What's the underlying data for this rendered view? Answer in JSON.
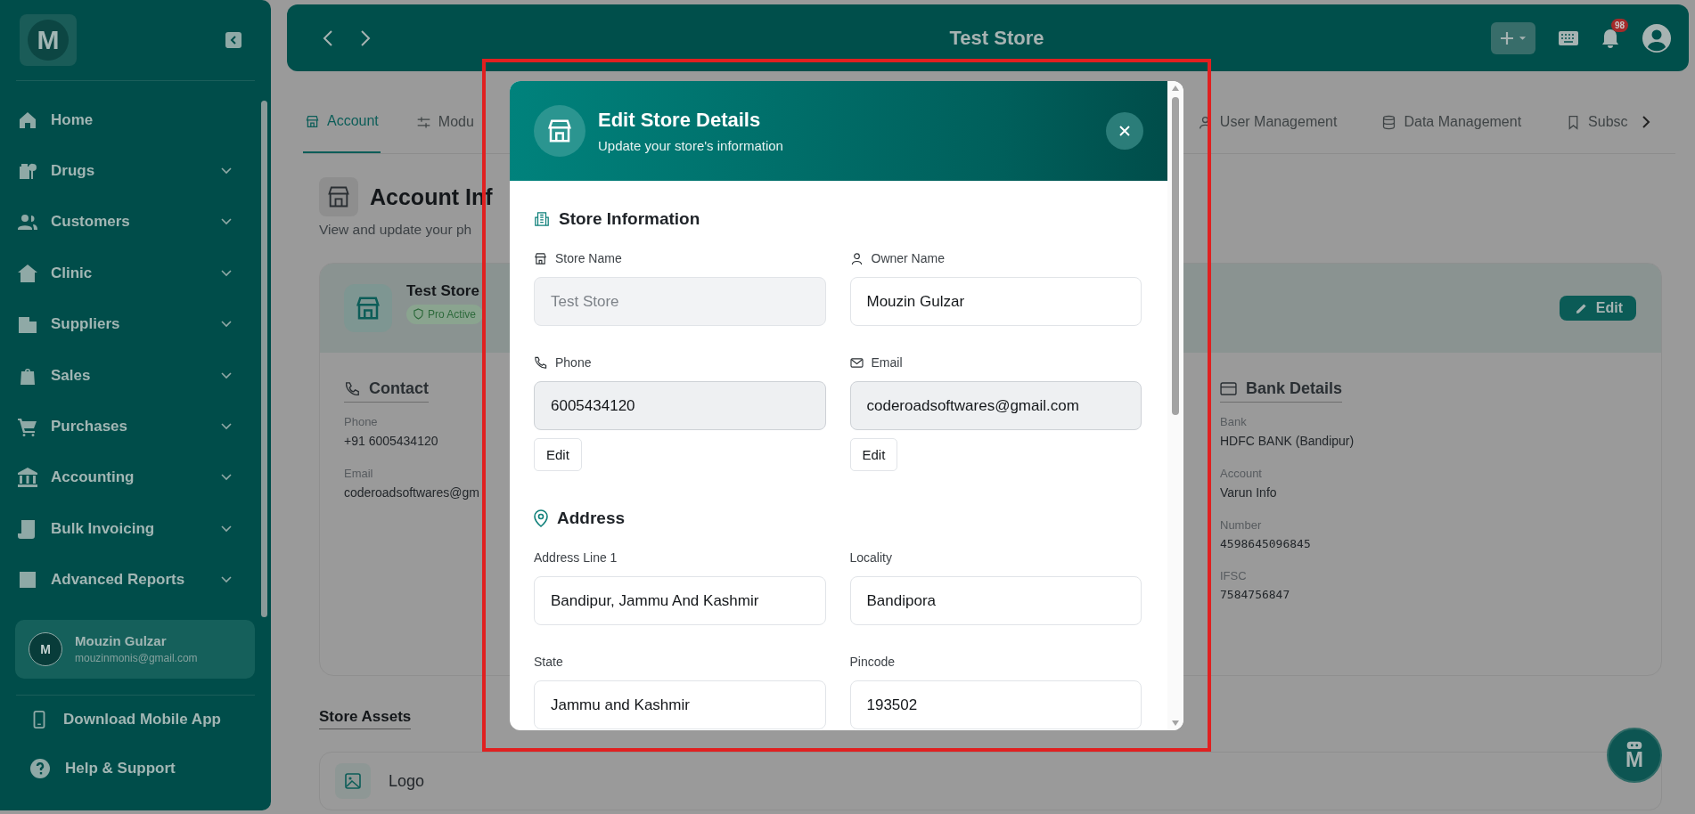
{
  "sidebar": {
    "logo": "M",
    "items": [
      {
        "label": "Home",
        "expandable": false
      },
      {
        "label": "Drugs",
        "expandable": true
      },
      {
        "label": "Customers",
        "expandable": true
      },
      {
        "label": "Clinic",
        "expandable": true
      },
      {
        "label": "Suppliers",
        "expandable": true
      },
      {
        "label": "Sales",
        "expandable": true
      },
      {
        "label": "Purchases",
        "expandable": true
      },
      {
        "label": "Accounting",
        "expandable": true
      },
      {
        "label": "Bulk Invoicing",
        "expandable": true
      },
      {
        "label": "Advanced Reports",
        "expandable": true
      }
    ],
    "user": {
      "initial": "M",
      "name": "Mouzin Gulzar",
      "email": "mouzinmonis@gmail.com"
    },
    "footer_links": [
      "Download Mobile App",
      "Help & Support"
    ]
  },
  "top_bar": {
    "title": "Test Store",
    "notification_count": "98"
  },
  "tabs": [
    {
      "label": "Account",
      "selected": true
    },
    {
      "label": "Modu",
      "selected": false
    },
    {
      "label": "User Management",
      "selected": false
    },
    {
      "label": "Data Management",
      "selected": false
    },
    {
      "label": "Subsc",
      "selected": false
    }
  ],
  "page": {
    "title": "Account Inf",
    "subtitle": "View and update your ph",
    "store_card": {
      "name": "Test Store",
      "badge": "Pro Active",
      "edit_label": "Edit",
      "contact": {
        "heading": "Contact",
        "fields": [
          {
            "label": "Phone",
            "value": "+91 6005434120"
          },
          {
            "label": "Email",
            "value": "coderoadsoftwares@gm"
          }
        ]
      },
      "bank": {
        "heading": "Bank Details",
        "fields": [
          {
            "label": "Bank",
            "value": "HDFC BANK (Bandipur)"
          },
          {
            "label": "Account",
            "value": "Varun Info"
          },
          {
            "label": "Number",
            "value": "4598645096845"
          },
          {
            "label": "IFSC",
            "value": "7584756847"
          }
        ]
      }
    },
    "assets": {
      "heading": "Store Assets",
      "items": [
        "Logo"
      ]
    }
  },
  "modal": {
    "title": "Edit Store Details",
    "subtitle": "Update your store's information",
    "sections": [
      {
        "heading": "Store Information",
        "fields": [
          {
            "label": "Store Name",
            "value": "Test Store",
            "disabled": true,
            "readonly": false
          },
          {
            "label": "Owner Name",
            "value": "Mouzin Gulzar",
            "disabled": false,
            "readonly": false
          },
          {
            "label": "Phone",
            "value": "6005434120",
            "disabled": false,
            "readonly": true,
            "edit_label": "Edit"
          },
          {
            "label": "Email",
            "value": "coderoadsoftwares@gmail.com",
            "disabled": false,
            "readonly": true,
            "edit_label": "Edit"
          }
        ]
      },
      {
        "heading": "Address",
        "fields": [
          {
            "label": "Address Line 1",
            "value": "Bandipur, Jammu And Kashmir",
            "disabled": false,
            "readonly": false
          },
          {
            "label": "Locality",
            "value": "Bandipora",
            "disabled": false,
            "readonly": false
          },
          {
            "label": "State",
            "value": "Jammu and Kashmir",
            "disabled": false,
            "readonly": false
          },
          {
            "label": "Pincode",
            "value": "193502",
            "disabled": false,
            "readonly": false
          }
        ]
      }
    ]
  },
  "chat_button": {
    "label": "M"
  }
}
